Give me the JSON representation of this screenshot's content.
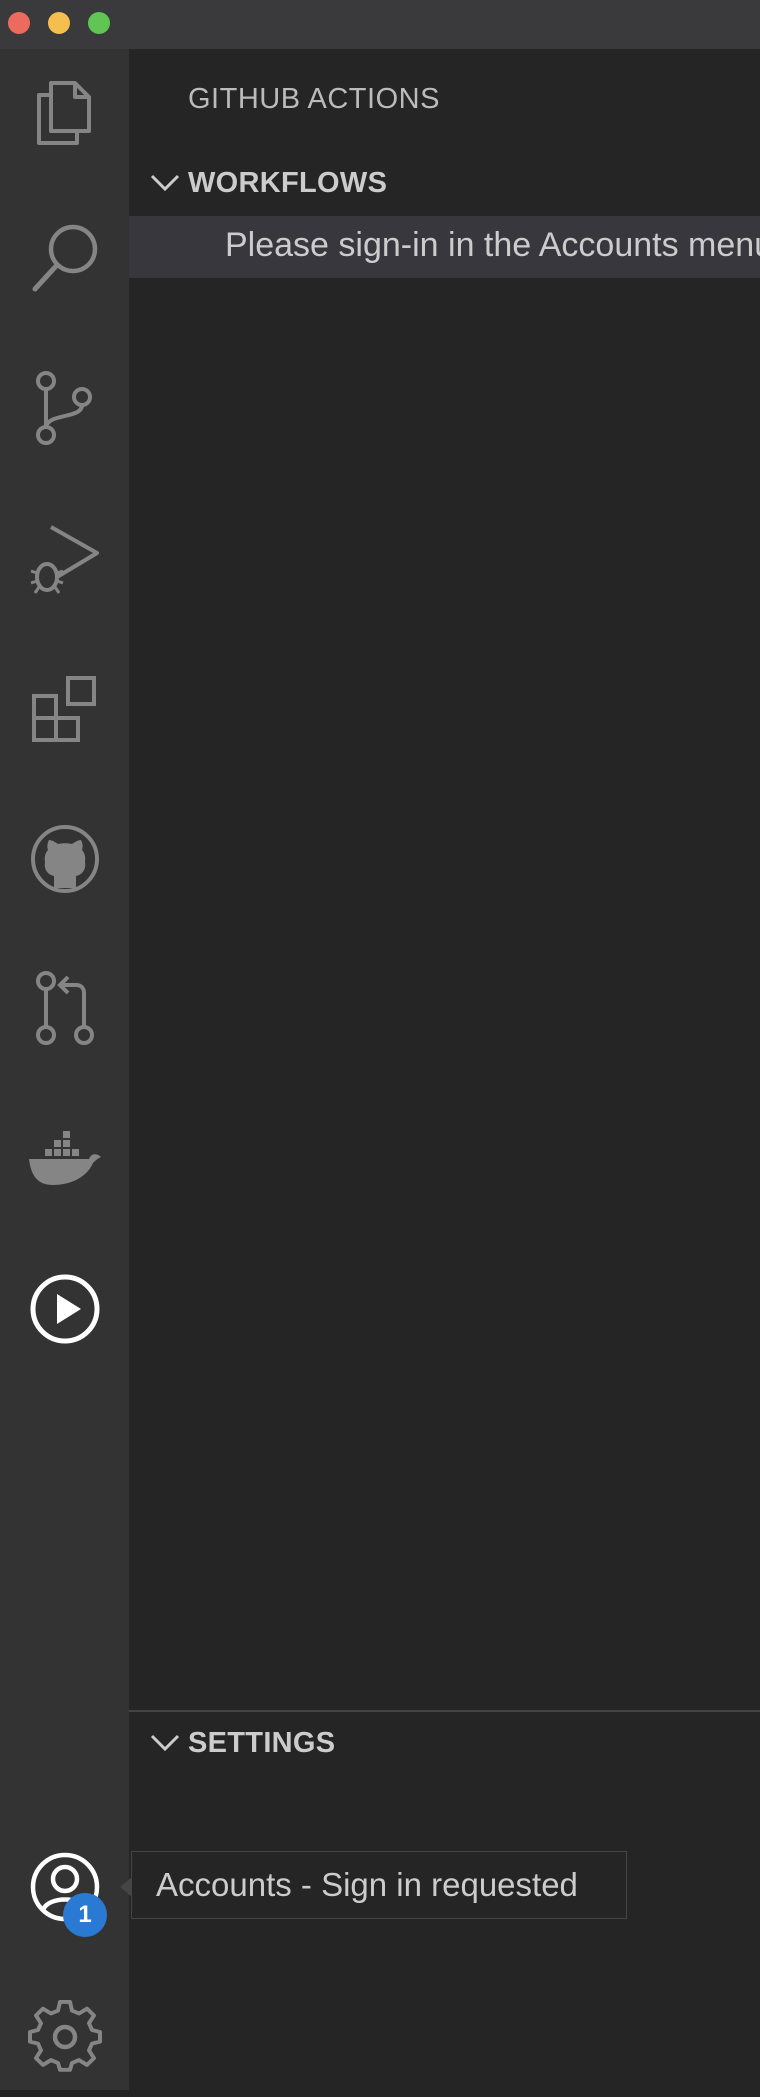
{
  "window": {
    "traffic_lights": [
      "close",
      "minimize",
      "maximize"
    ]
  },
  "activity_bar": {
    "items": [
      {
        "name": "explorer",
        "icon": "files-icon",
        "active": false
      },
      {
        "name": "search",
        "icon": "search-icon",
        "active": false
      },
      {
        "name": "source-control",
        "icon": "source-control-icon",
        "active": false
      },
      {
        "name": "run-and-debug",
        "icon": "run-debug-icon",
        "active": false
      },
      {
        "name": "extensions",
        "icon": "extensions-icon",
        "active": false
      },
      {
        "name": "github",
        "icon": "github-icon",
        "active": false
      },
      {
        "name": "pull-requests",
        "icon": "pull-request-icon",
        "active": false
      },
      {
        "name": "docker",
        "icon": "docker-icon",
        "active": false
      },
      {
        "name": "github-actions",
        "icon": "play-circle-icon",
        "active": true
      }
    ],
    "accounts": {
      "icon": "account-icon",
      "badge": "1"
    },
    "manage": {
      "icon": "gear-icon"
    }
  },
  "sidebar": {
    "title": "GITHUB ACTIONS",
    "sections": [
      {
        "label": "WORKFLOWS",
        "expanded": true,
        "items": [
          "Please sign-in in the Accounts menu."
        ]
      },
      {
        "label": "SETTINGS",
        "expanded": true,
        "items": []
      }
    ]
  },
  "tooltip": {
    "text": "Accounts - Sign in requested"
  },
  "colors": {
    "activity_bar_bg": "#333333",
    "sidebar_bg": "#252526",
    "selected_item_bg": "#37373d",
    "badge_bg": "#2a7ad4",
    "inactive_icon": "#858585",
    "active_icon": "#ffffff"
  }
}
